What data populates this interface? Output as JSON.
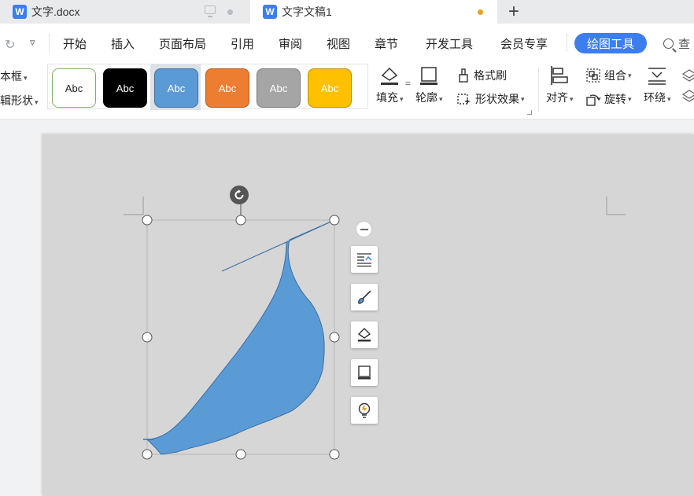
{
  "tabs": [
    {
      "title": "文字.docx",
      "active": false
    },
    {
      "title": "文字文稿1",
      "active": true
    }
  ],
  "new_tab_label": "+",
  "menu": {
    "items": [
      "开始",
      "插入",
      "页面布局",
      "引用",
      "审阅",
      "视图",
      "章节",
      "开发工具",
      "会员专享"
    ],
    "active_tool": "绘图工具",
    "search_label": "查"
  },
  "ribbon": {
    "left_top": "本框",
    "left_bottom": "辑形状",
    "styles": [
      {
        "label": "Abc",
        "bg": "#ffffff",
        "fg": "#222222",
        "border": "#7fb26a"
      },
      {
        "label": "Abc",
        "bg": "#000000",
        "fg": "#ffffff",
        "border": "#000000"
      },
      {
        "label": "Abc",
        "bg": "#5b9bd5",
        "fg": "#ffffff",
        "border": "#41719c"
      },
      {
        "label": "Abc",
        "bg": "#ed7d31",
        "fg": "#ffffff",
        "border": "#ae5a21"
      },
      {
        "label": "Abc",
        "bg": "#a5a5a5",
        "fg": "#ffffff",
        "border": "#787878"
      },
      {
        "label": "Abc",
        "bg": "#ffc000",
        "fg": "#ffffff",
        "border": "#bc8c00"
      }
    ],
    "gallery_more": "=",
    "fill": "填充",
    "outline": "轮廓",
    "format_painter": "格式刷",
    "shape_effect": "形状效果",
    "align": "对齐",
    "group": "组合",
    "rotate": "旋转",
    "wrap": "环绕"
  },
  "colors": {
    "accent": "#3c7df0",
    "shape_fill": "#5b9bd5",
    "shape_stroke": "#3a6ea5"
  },
  "float_toolbar": [
    "layout-options-icon",
    "brush-icon",
    "fill-icon",
    "outline-icon",
    "lightbulb-icon"
  ]
}
